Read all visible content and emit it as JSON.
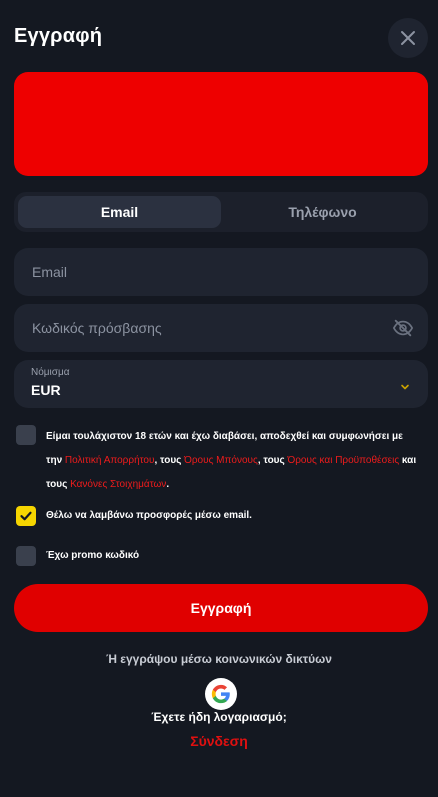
{
  "header": {
    "title": "Εγγραφή",
    "close_icon": "close-icon"
  },
  "banner": {
    "color": "#ee0000"
  },
  "tabs": [
    {
      "label": "Email",
      "active": true
    },
    {
      "label": "Τηλέφωνο",
      "active": false
    }
  ],
  "form": {
    "email": {
      "placeholder": "Email",
      "value": ""
    },
    "password": {
      "placeholder": "Κωδικός πρόσβασης",
      "value": "",
      "icon": "eye-off-icon"
    },
    "currency": {
      "label": "Νόμισμα",
      "value": "EUR",
      "icon": "chevron-down-icon"
    }
  },
  "consent": {
    "checked": false,
    "part1": "Είμαι τουλάχιστον 18 ετών και έχω διαβάσει, αποδεχθεί και συμφωνήσει με την ",
    "link_privacy": "Πολιτική Απορρήτου",
    "part2": ", τους ",
    "link_bonus": "Όρους Μπόνους",
    "part3": ", τους ",
    "link_terms": "Όρους και Προϋποθέσεις",
    "part4": " και τους ",
    "link_rules": "Κανόνες Στοιχημάτων",
    "part5": "."
  },
  "offers": {
    "checked": true,
    "label": "Θέλω να λαμβάνω προσφορές μέσω email."
  },
  "promo": {
    "checked": false,
    "label": "Έχω promo κωδικό"
  },
  "submit_label": "Εγγραφή",
  "social": {
    "label": "Ή εγγράψου μέσω κοινωνικών δικτύων",
    "google_icon": "google-icon"
  },
  "account": {
    "question": "Έχετε ήδη λογαριασμό;",
    "login_label": "Σύνδεση"
  },
  "colors": {
    "accent": "#e00000",
    "checkbox_checked": "#f6d500",
    "background": "#141821"
  }
}
